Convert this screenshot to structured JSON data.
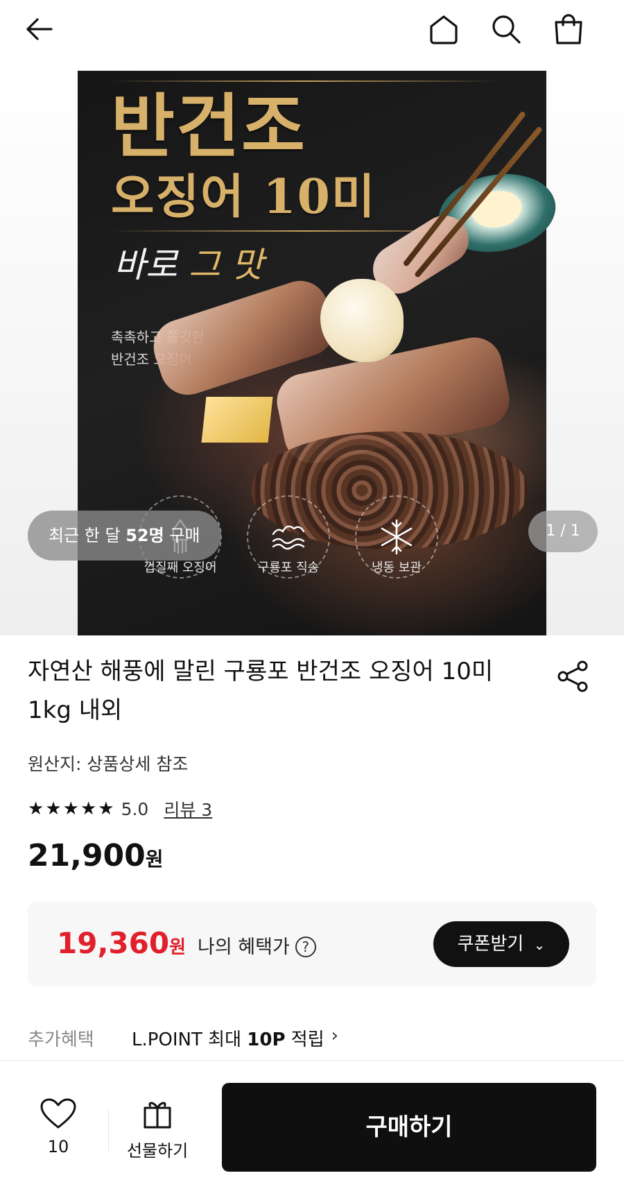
{
  "header": {
    "back_icon": "arrow-left-icon",
    "home_icon": "home-icon",
    "search_icon": "search-icon",
    "cart_icon": "shopping-bag-icon"
  },
  "hero": {
    "title_line1": "반건조",
    "title_line2": "오징어 10미",
    "script_part1": "바로 ",
    "script_part2": "그 맛",
    "subtext_line1": "촉촉하고 쫄깃한",
    "subtext_line2": "반건조 오징어",
    "badges": [
      {
        "icon": "squid-icon",
        "label": "껍질째 오징어"
      },
      {
        "icon": "waves-icon",
        "label": "구룡포 직송"
      },
      {
        "icon": "snowflake-icon",
        "label": "냉동 보관"
      }
    ],
    "recent_prefix": "최근 한 달 ",
    "recent_count": "52명",
    "recent_suffix": " 구매",
    "page_indicator": "1 / 1"
  },
  "product": {
    "title": "자연산 해풍에 말린 구룡포 반건조 오징어 10미 1kg 내외",
    "origin": "원산지: 상품상세 참조",
    "stars": 5,
    "rating": "5.0",
    "reviews": "리뷰 3",
    "price": "21,900",
    "price_unit": "원",
    "share_icon": "share-icon"
  },
  "benefit": {
    "price": "19,360",
    "price_unit": "원",
    "label": "나의 혜택가",
    "help_icon": "?",
    "coupon_label": "쿠폰받기",
    "accent": "#e0202a"
  },
  "extra": {
    "label": "추가혜택",
    "text_prefix": "L.POINT 최대 ",
    "text_bold": "10P",
    "text_suffix": " 적립",
    "chevron": "›"
  },
  "bottom": {
    "wish_count": "10",
    "gift_label": "선물하기",
    "buy_label": "구매하기"
  }
}
